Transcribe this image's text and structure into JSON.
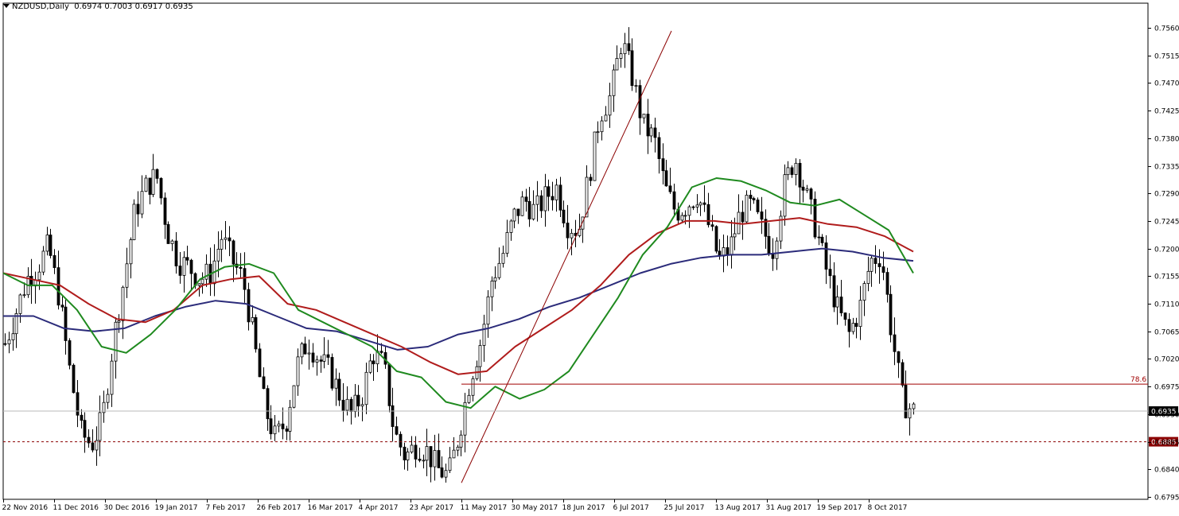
{
  "header": {
    "symbol": "NZDUSD,Daily",
    "ohlc": "0.6974 0.7003 0.6917 0.6935"
  },
  "colors": {
    "ma_fast": "#1f8a1f",
    "ma_mid": "#b01c1c",
    "ma_slow": "#2b2b7a",
    "fib_line": "#a00000",
    "current_price_line": "#b8b8b8",
    "support_line": "#8b0000",
    "trend_line": "#8b0000"
  },
  "chart_data": {
    "type": "candlestick",
    "ylim": [
      0.6795,
      0.756
    ],
    "y_ticks": [
      "0.7560",
      "0.7515",
      "0.7470",
      "0.7425",
      "0.7380",
      "0.7335",
      "0.7290",
      "0.7245",
      "0.7200",
      "0.7155",
      "0.7110",
      "0.7065",
      "0.7020",
      "0.6975",
      "0.6930",
      "0.6885",
      "0.6840",
      "0.6795"
    ],
    "x_ticks": [
      "22 Nov 2016",
      "11 Dec 2016",
      "30 Dec 2016",
      "19 Jan 2017",
      "7 Feb 2017",
      "26 Feb 2017",
      "16 Mar 2017",
      "4 Apr 2017",
      "23 Apr 2017",
      "11 May 2017",
      "30 May 2017",
      "18 Jun 2017",
      "6 Jul 2017",
      "25 Jul 2017",
      "13 Aug 2017",
      "31 Aug 2017",
      "19 Sep 2017",
      "8 Oct 2017"
    ],
    "last_price": {
      "value": 0.6935,
      "label": "0.6935"
    },
    "support_level": {
      "value": 0.6885,
      "label": "0.6885"
    },
    "fib_level": {
      "value": 0.6979,
      "label": "78.6"
    },
    "trend_line": {
      "start_price": 0.6818,
      "end_price": 0.7555
    },
    "close_path": [
      0.7045,
      0.7095,
      0.715,
      0.717,
      0.7205,
      0.712,
      0.7,
      0.69,
      0.688,
      0.692,
      0.705,
      0.715,
      0.726,
      0.73,
      0.732,
      0.723,
      0.718,
      0.717,
      0.715,
      0.716,
      0.722,
      0.718,
      0.715,
      0.705,
      0.694,
      0.689,
      0.692,
      0.701,
      0.705,
      0.702,
      0.7,
      0.696,
      0.693,
      0.696,
      0.703,
      0.701,
      0.69,
      0.686,
      0.688,
      0.687,
      0.684,
      0.683,
      0.69,
      0.699,
      0.705,
      0.715,
      0.719,
      0.725,
      0.728,
      0.726,
      0.7285,
      0.73,
      0.724,
      0.723,
      0.732,
      0.742,
      0.745,
      0.754,
      0.748,
      0.74,
      0.738,
      0.73,
      0.726,
      0.727,
      0.729,
      0.724,
      0.718,
      0.72,
      0.726,
      0.727,
      0.723,
      0.72,
      0.73,
      0.735,
      0.729,
      0.723,
      0.716,
      0.71,
      0.706,
      0.71,
      0.718,
      0.719,
      0.706,
      0.695,
      0.6935
    ],
    "ma_fast": [
      0.716,
      0.714,
      0.714,
      0.71,
      0.704,
      0.703,
      0.706,
      0.71,
      0.715,
      0.717,
      0.7175,
      0.716,
      0.71,
      0.708,
      0.706,
      0.704,
      0.7,
      0.699,
      0.695,
      0.694,
      0.6975,
      0.6955,
      0.697,
      0.7,
      0.706,
      0.712,
      0.719,
      0.7235,
      0.73,
      0.7315,
      0.731,
      0.7295,
      0.7275,
      0.727,
      0.728,
      0.7255,
      0.723,
      0.716
    ],
    "ma_mid": [
      0.716,
      0.715,
      0.714,
      0.711,
      0.7085,
      0.708,
      0.71,
      0.714,
      0.715,
      0.7155,
      0.711,
      0.71,
      0.708,
      0.706,
      0.704,
      0.7015,
      0.6995,
      0.7,
      0.704,
      0.707,
      0.71,
      0.714,
      0.719,
      0.7225,
      0.7245,
      0.7245,
      0.724,
      0.7245,
      0.725,
      0.724,
      0.7235,
      0.722,
      0.7195
    ],
    "ma_slow": [
      0.709,
      0.709,
      0.707,
      0.7065,
      0.707,
      0.709,
      0.7105,
      0.7115,
      0.711,
      0.709,
      0.707,
      0.7065,
      0.705,
      0.7035,
      0.704,
      0.706,
      0.707,
      0.7085,
      0.7105,
      0.712,
      0.714,
      0.716,
      0.7175,
      0.7185,
      0.719,
      0.719,
      0.7195,
      0.72,
      0.7195,
      0.7185,
      0.718
    ]
  }
}
